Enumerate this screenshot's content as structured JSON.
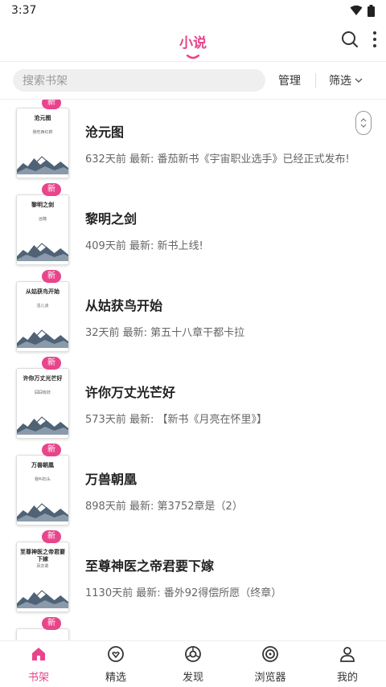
{
  "status": {
    "time": "3:37"
  },
  "header": {
    "title": "小说"
  },
  "search": {
    "placeholder": "搜索书架",
    "manage_label": "管理",
    "filter_label": "筛选"
  },
  "badge_label": "新",
  "books": [
    {
      "title": "沧元图",
      "cover_title": "沧元图",
      "cover_author": "我吃西红柿",
      "latest": "632天前 最新: 番茄新书《宇宙职业选手》已经正式发布!"
    },
    {
      "title": "黎明之剑",
      "cover_title": "黎明之剑",
      "cover_author": "远瞳",
      "latest": "409天前 最新: 新书上线!"
    },
    {
      "title": "从姑获鸟开始",
      "cover_title": "从姑获鸟开始",
      "cover_author": "活儿该",
      "latest": "32天前 最新: 第五十八章干都卡拉"
    },
    {
      "title": "许你万丈光芒好",
      "cover_title": "许你万丈光芒好",
      "cover_author": "囧囧有妖",
      "latest": "573天前 最新: 【新书《月亮在怀里》】"
    },
    {
      "title": "万兽朝凰",
      "cover_title": "万兽朝凰",
      "cover_author": "我叫石头",
      "latest": "898天前 最新: 第3752章是（2）"
    },
    {
      "title": "至尊神医之帝君要下嫁",
      "cover_title": "至尊神医之帝君要下嫁",
      "cover_author": "凤亦柔",
      "latest": "1130天前 最新: 番外92得偿所愿（终章）"
    }
  ],
  "nav": [
    {
      "label": "书架",
      "icon": "bookshelf-icon",
      "active": true
    },
    {
      "label": "精选",
      "icon": "featured-icon",
      "active": false
    },
    {
      "label": "发现",
      "icon": "discover-icon",
      "active": false
    },
    {
      "label": "浏览器",
      "icon": "browser-icon",
      "active": false
    },
    {
      "label": "我的",
      "icon": "profile-icon",
      "active": false
    }
  ],
  "colors": {
    "accent": "#e8458b"
  }
}
